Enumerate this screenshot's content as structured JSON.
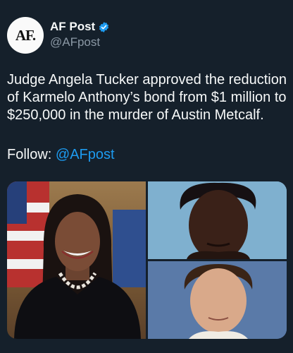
{
  "post": {
    "display_name": "AF Post",
    "handle": "@AFpost",
    "avatar_text": "AF.",
    "body": "Judge Angela Tucker approved the reduction of Karmelo Anthony’s bond from $1 million to $250,000 in the murder of Austin Metcalf.",
    "follow_label": "Follow: ",
    "follow_mention": "@AFpost"
  },
  "colors": {
    "background": "#15202b",
    "text": "#f7f9f9",
    "secondary_text": "#8b98a5",
    "accent": "#1d9bf0"
  },
  "icons": {
    "verified": "verified-badge-icon"
  }
}
